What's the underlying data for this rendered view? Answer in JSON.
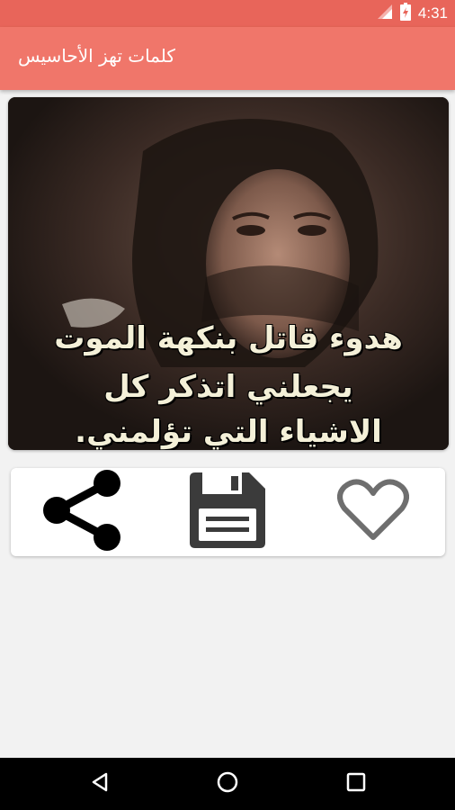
{
  "status_bar": {
    "time": "4:31",
    "icons": [
      "wifi-icon",
      "battery-icon"
    ]
  },
  "app_bar": {
    "title": "كلمات تهز الأحاسيس"
  },
  "image_card": {
    "quote_lines": [
      "هدوء قاتل بنكهة الموت",
      "يجعلني اتذكر كل",
      "الاشياء التي تؤلمني."
    ]
  },
  "actions": {
    "icons": [
      "share-icon",
      "save-icon",
      "heart-icon"
    ]
  },
  "nav_bar": {
    "icons": [
      "back-icon",
      "home-icon",
      "recents-icon"
    ]
  },
  "colors": {
    "status_bar": "#e8655a",
    "app_bar": "#f0766a",
    "background": "#f2f2f2"
  }
}
